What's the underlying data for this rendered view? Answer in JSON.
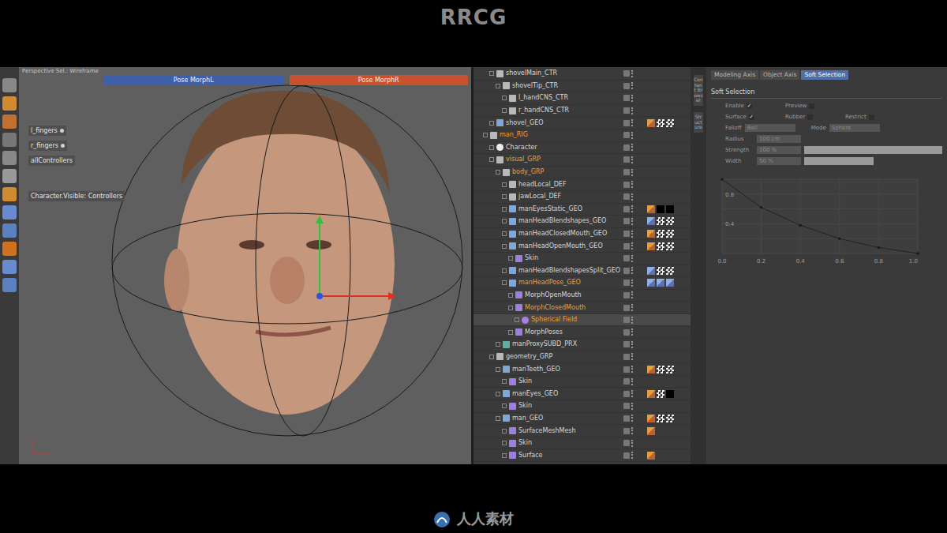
{
  "watermark": {
    "top": "RRCG",
    "bottom": "人人素材"
  },
  "viewport": {
    "camera": "Perspective Sel.: Wireframe",
    "pose_bars": [
      {
        "label": "Pose MorphL",
        "color": "#3f5fa8"
      },
      {
        "label": "Pose MorphR",
        "color": "#c8522e"
      }
    ],
    "labels": [
      "l_fingers",
      "r_fingers",
      "allControllers",
      "Character.Visible: Controllers"
    ]
  },
  "objects": [
    {
      "name": "shovelMain_CTR",
      "depth": 1,
      "kind": "null",
      "highlighted": false,
      "selected": false,
      "tags": []
    },
    {
      "name": "shovelTip_CTR",
      "depth": 2,
      "kind": "null",
      "highlighted": false,
      "selected": false,
      "tags": []
    },
    {
      "name": "l_handCNS_CTR",
      "depth": 3,
      "kind": "null",
      "highlighted": false,
      "selected": false,
      "tags": []
    },
    {
      "name": "r_handCNS_CTR",
      "depth": 3,
      "kind": "null",
      "highlighted": false,
      "selected": false,
      "tags": []
    },
    {
      "name": "shovel_GEO",
      "depth": 1,
      "kind": "geo",
      "highlighted": false,
      "selected": false,
      "tags": [
        "vertex",
        "checker",
        "checker"
      ]
    },
    {
      "name": "man_RIG",
      "depth": 0,
      "kind": "null",
      "highlighted": true,
      "selected": false,
      "tags": []
    },
    {
      "name": "Character",
      "depth": 1,
      "kind": "character",
      "highlighted": false,
      "selected": false,
      "tags": []
    },
    {
      "name": "visual_GRP",
      "depth": 1,
      "kind": "null",
      "highlighted": true,
      "selected": false,
      "tags": []
    },
    {
      "name": "body_GRP",
      "depth": 2,
      "kind": "null",
      "highlighted": true,
      "selected": false,
      "tags": []
    },
    {
      "name": "headLocal_DEF",
      "depth": 3,
      "kind": "null",
      "highlighted": false,
      "selected": false,
      "tags": []
    },
    {
      "name": "jawLocal_DEF",
      "depth": 3,
      "kind": "null",
      "highlighted": false,
      "selected": false,
      "tags": []
    },
    {
      "name": "manEyesStatic_GEO",
      "depth": 3,
      "kind": "geo",
      "highlighted": false,
      "selected": false,
      "tags": [
        "vertex",
        "black",
        "black"
      ]
    },
    {
      "name": "manHeadBlendshapes_GEO",
      "depth": 3,
      "kind": "geo",
      "highlighted": false,
      "selected": false,
      "tags": [
        "morph",
        "checker",
        "checker"
      ]
    },
    {
      "name": "manHeadClosedMouth_GEO",
      "depth": 3,
      "kind": "geo",
      "highlighted": false,
      "selected": false,
      "tags": [
        "vertex",
        "checker",
        "checker"
      ]
    },
    {
      "name": "manHeadOpenMouth_GEO",
      "depth": 3,
      "kind": "geo",
      "highlighted": false,
      "selected": false,
      "tags": [
        "vertex",
        "checker",
        "checker"
      ]
    },
    {
      "name": "Skin",
      "depth": 4,
      "kind": "deformer",
      "highlighted": false,
      "selected": false,
      "tags": []
    },
    {
      "name": "manHeadBlendshapesSplit_GEO",
      "depth": 3,
      "kind": "geo",
      "highlighted": false,
      "selected": false,
      "tags": [
        "morph",
        "checker",
        "checker"
      ]
    },
    {
      "name": "manHeadPose_GEO",
      "depth": 3,
      "kind": "geo",
      "highlighted": true,
      "selected": false,
      "tags": [
        "morph",
        "morph",
        "morph"
      ]
    },
    {
      "name": "MorphOpenMouth",
      "depth": 4,
      "kind": "deformer",
      "highlighted": false,
      "selected": false,
      "tags": []
    },
    {
      "name": "MorphClosedMouth",
      "depth": 4,
      "kind": "deformer",
      "highlighted": true,
      "selected": false,
      "tags": []
    },
    {
      "name": "Spherical Field",
      "depth": 5,
      "kind": "field",
      "highlighted": true,
      "selected": true,
      "tags": []
    },
    {
      "name": "MorphPoses",
      "depth": 4,
      "kind": "deformer",
      "highlighted": false,
      "selected": false,
      "tags": []
    },
    {
      "name": "manProxySUBD_PRX",
      "depth": 2,
      "kind": "subd",
      "highlighted": false,
      "selected": false,
      "tags": []
    },
    {
      "name": "geometry_GRP",
      "depth": 1,
      "kind": "null",
      "highlighted": false,
      "selected": false,
      "tags": []
    },
    {
      "name": "manTeeth_GEO",
      "depth": 2,
      "kind": "geo",
      "highlighted": false,
      "selected": false,
      "tags": [
        "vertex",
        "checker",
        "checker"
      ]
    },
    {
      "name": "Skin",
      "depth": 3,
      "kind": "deformer",
      "highlighted": false,
      "selected": false,
      "tags": []
    },
    {
      "name": "manEyes_GEO",
      "depth": 2,
      "kind": "geo",
      "highlighted": false,
      "selected": false,
      "tags": [
        "vertex",
        "checker",
        "black"
      ]
    },
    {
      "name": "Skin",
      "depth": 3,
      "kind": "deformer",
      "highlighted": false,
      "selected": false,
      "tags": []
    },
    {
      "name": "man_GEO",
      "depth": 2,
      "kind": "geo",
      "highlighted": false,
      "selected": false,
      "tags": [
        "vertex",
        "checker",
        "checker"
      ]
    },
    {
      "name": "SurfaceMeshMesh",
      "depth": 3,
      "kind": "deformer",
      "highlighted": false,
      "selected": false,
      "tags": [
        "vertex"
      ]
    },
    {
      "name": "Skin",
      "depth": 3,
      "kind": "deformer",
      "highlighted": false,
      "selected": false,
      "tags": []
    },
    {
      "name": "Surface",
      "depth": 3,
      "kind": "deformer",
      "highlighted": false,
      "selected": false,
      "tags": [
        "vertex"
      ]
    }
  ],
  "attributes": {
    "tabs": [
      {
        "label": "Modeling Axis",
        "selected": false
      },
      {
        "label": "Object Axis",
        "selected": false
      },
      {
        "label": "Soft Selection",
        "selected": true
      }
    ],
    "title": "Soft Selection",
    "checks": [
      [
        {
          "label": "Enable",
          "checked": true
        },
        {
          "label": "Preview",
          "checked": false
        }
      ],
      [
        {
          "label": "Surface",
          "checked": true
        },
        {
          "label": "Rubber",
          "checked": false
        },
        {
          "label": "Restrict",
          "checked": false
        }
      ]
    ],
    "selects": [
      {
        "label": "Falloff",
        "value": "Bell"
      },
      {
        "label": "Mode",
        "value": "Sphere"
      }
    ],
    "fields": [
      {
        "label": "Radius",
        "value": "100 cm",
        "kind": "field"
      },
      {
        "label": "Strength",
        "value": "100 %",
        "kind": "slider",
        "level": 1.0
      },
      {
        "label": "Width",
        "value": "50 %",
        "kind": "slider",
        "level": 0.5
      }
    ],
    "graph": {
      "x_ticks": [
        "0.0",
        "0.2",
        "0.4",
        "0.6",
        "0.8",
        "1.0"
      ],
      "y_ticks": [
        "0.8",
        "0.4"
      ],
      "curve": [
        1.0,
        0.62,
        0.38,
        0.2,
        0.08,
        0.0
      ]
    }
  },
  "side_tabs": [
    "Content Browser",
    "Structure"
  ]
}
